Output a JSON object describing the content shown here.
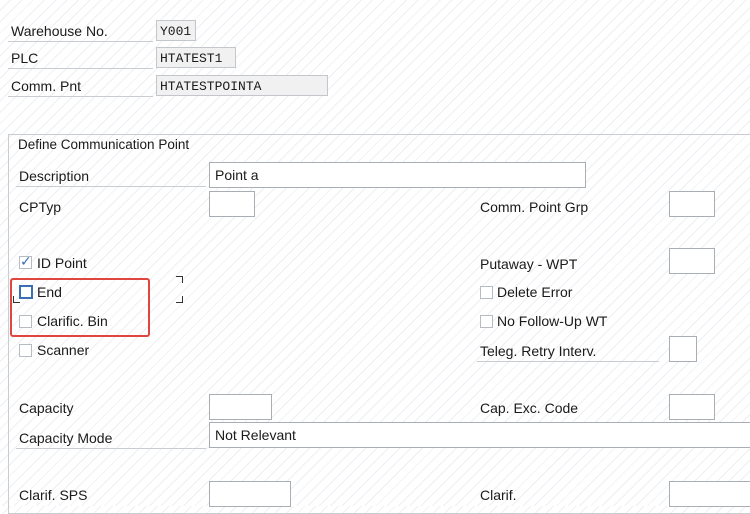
{
  "header": {
    "warehouse_label": "Warehouse No.",
    "warehouse_value": "Y001",
    "plc_label": "PLC",
    "plc_value": "HTATEST1",
    "comm_label": "Comm. Pnt",
    "comm_value": "HTATESTPOINTA"
  },
  "group": {
    "title": "Define Communication Point",
    "description_label": "Description",
    "description_value": "Point a",
    "cptyp_label": "CPTyp",
    "cptyp_value": "",
    "comm_grp_label": "Comm. Point Grp",
    "comm_grp_value": "",
    "putaway_label": "Putaway - WPT",
    "putaway_value": "",
    "teleg_label": "Teleg. Retry Interv.",
    "teleg_value": "",
    "capacity_label": "Capacity",
    "capacity_value": "",
    "capexc_label": "Cap. Exc. Code",
    "capexc_value": "",
    "capmode_label": "Capacity Mode",
    "capmode_value": "Not Relevant",
    "clarif_sps_label": "Clarif. SPS",
    "clarif_sps_value": "",
    "clarif_label": "Clarif.",
    "clarif_value": ""
  },
  "checkboxes": {
    "id_point": {
      "label": "ID Point",
      "checked": true
    },
    "end": {
      "label": "End",
      "checked": false
    },
    "clarific_bin": {
      "label": "Clarific. Bin",
      "checked": false
    },
    "scanner": {
      "label": "Scanner",
      "checked": false
    },
    "delete_error": {
      "label": "Delete Error",
      "checked": false
    },
    "no_followup": {
      "label": "No Follow-Up WT",
      "checked": false
    }
  },
  "colors": {
    "highlight": "#e0453f",
    "checkbox_accent": "#3c6fb0"
  }
}
